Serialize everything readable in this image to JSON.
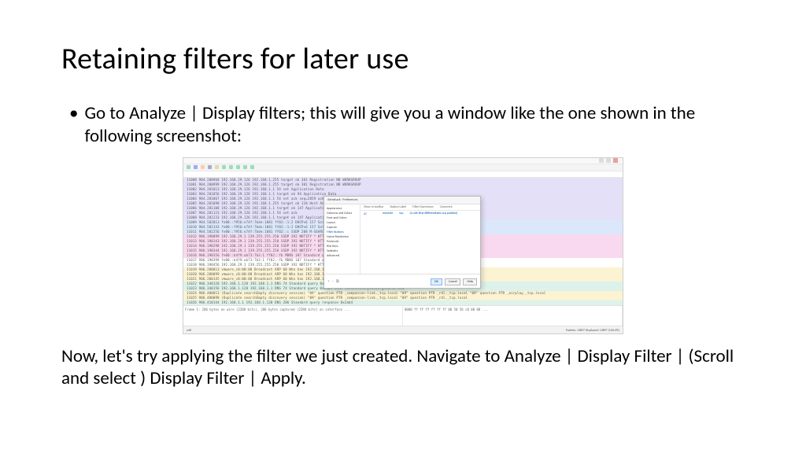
{
  "title": "Retaining filters for later use",
  "bullet1": "Go to Analyze | Display filters; this will give you a window like the one shown in the following screenshot:",
  "followup": "Now, let's try applying the filter we just created. Navigate to Analyze | Display Filter | (Scroll and select ) Display Filter | Apply.",
  "screenshot": {
    "dialog_title": "Wireshark · Preferences",
    "sidebar": [
      "Appearance",
      "Columns and Colors",
      "Font and Colors",
      "Layout",
      "Capture",
      "Filter Buttons",
      "Name Resolution",
      "Protocols",
      "RSA Keys",
      "Statistics",
      "Advanced"
    ],
    "sidebar_selected": "Filter Buttons",
    "table_headers": [
      "Show in toolbar",
      "Button Label",
      "Filter Expression",
      "Comment"
    ],
    "table_row": [
      "",
      "newrule",
      "tcp",
      "(a rule that differentiates tcp packets)"
    ],
    "buttons": {
      "ok": "OK",
      "cancel": "Cancel",
      "help": "Help"
    },
    "status_left": "wifi",
    "status_right": "Packets: 13897   Displayed: 13897 (100.0%)",
    "bottom_text_l": "Frame 1: 286 bytes on wire (2288 bits), 286 bytes captured (2288 bits) on interface ...",
    "bottom_text_r": "0000  ff ff ff ff ff ff 00 50  56 c0 00 08  ..."
  }
}
